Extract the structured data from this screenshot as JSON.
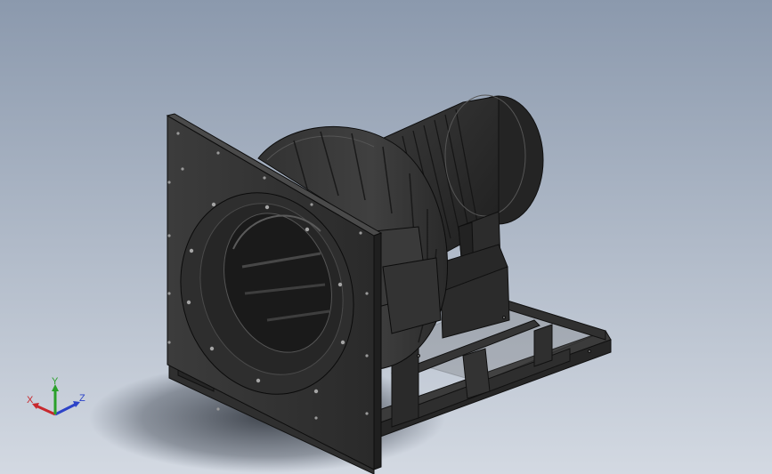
{
  "view": {
    "background_top": "#8b99ad",
    "background_bottom": "#d3d9e2"
  },
  "triad": {
    "x_label": "X",
    "y_label": "Y",
    "z_label": "Z",
    "x_color": "#c8282d",
    "y_color": "#2aa02a",
    "z_color": "#2c43c8"
  }
}
